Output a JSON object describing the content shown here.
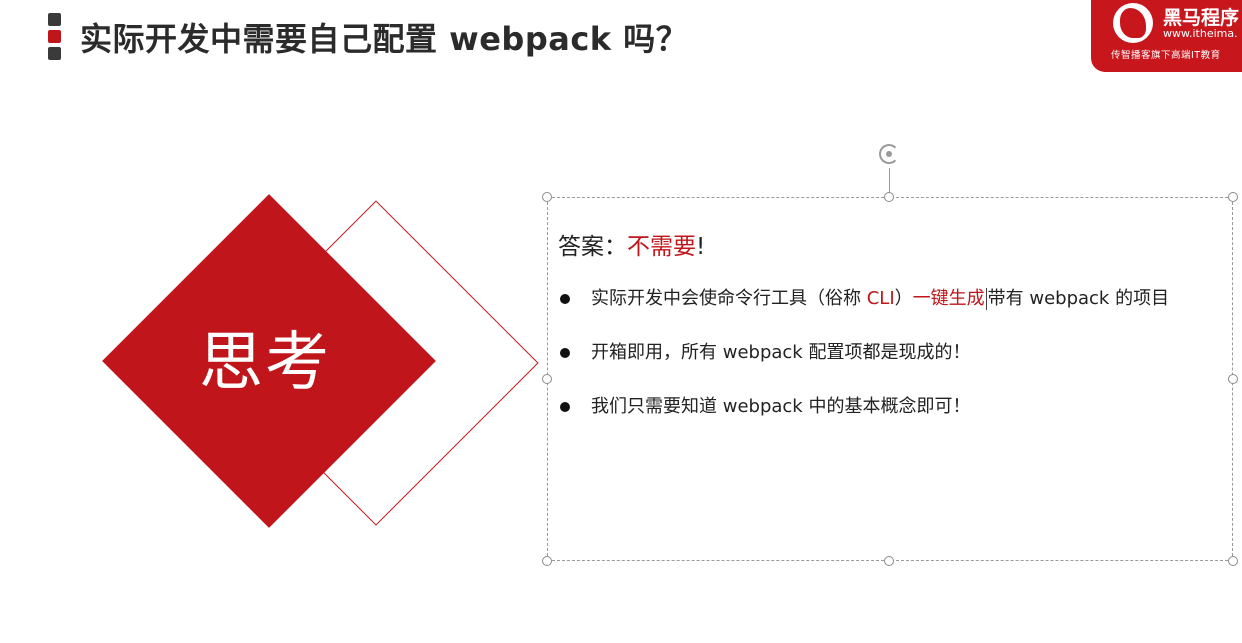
{
  "title": "实际开发中需要自己配置 webpack 吗？",
  "logo": {
    "name": "黑马程序",
    "url": "www.itheima.",
    "slogan": "传智播客旗下高端IT教育"
  },
  "graphic": {
    "label": "思考"
  },
  "answer": {
    "prefix": "答案：",
    "value": "不需要",
    "suffix": "!"
  },
  "bullets": [
    {
      "part1": "实际开发中会使命令行工具（俗称 ",
      "cli": "CLI",
      "part2": "）",
      "highlight": "一键生成",
      "part3": "带有 webpack 的项目"
    },
    {
      "text": "开箱即用，所有 webpack 配置项都是现成的！"
    },
    {
      "text": "我们只需要知道 webpack 中的基本概念即可！"
    }
  ],
  "colors": {
    "accent": "#c0151a",
    "logo_bg": "#c8161d",
    "text": "#222222"
  },
  "icons": [
    "rotate-handle-icon",
    "logo-horse-icon",
    "bullet-dot-icon"
  ]
}
